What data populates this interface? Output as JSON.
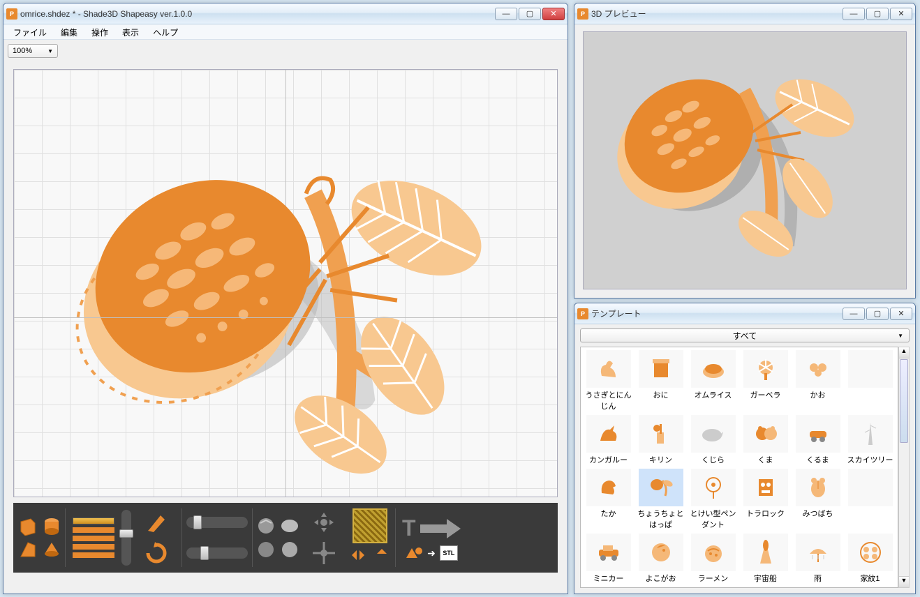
{
  "main": {
    "title": "omrice.shdez *  - Shade3D Shapeasy ver.1.0.0",
    "menu": [
      "ファイル",
      "編集",
      "操作",
      "表示",
      "ヘルプ"
    ],
    "zoom": "100%"
  },
  "preview": {
    "title": "3D プレビュー"
  },
  "templates": {
    "title": "テンプレート",
    "filter": "すべて",
    "items": [
      "うさぎとにんじん",
      "おに",
      "オムライス",
      "ガーベラ",
      "かお",
      "",
      "カンガルー",
      "キリン",
      "くじら",
      "くま",
      "くるま",
      "スカイツリー",
      "たか",
      "ちょうちょとはっぱ",
      "とけい型ペンダント",
      "トラロック",
      "みつばち",
      "",
      "ミニカー",
      "よこがお",
      "ラーメン",
      "宇宙船",
      "雨",
      "家紋1"
    ],
    "selected_index": 13
  },
  "colors": {
    "orange_dark": "#e8892e",
    "orange_mid": "#f0a050",
    "orange_light": "#f8c890",
    "gray_shadow": "#b0b0b0"
  },
  "export_label": "STL"
}
